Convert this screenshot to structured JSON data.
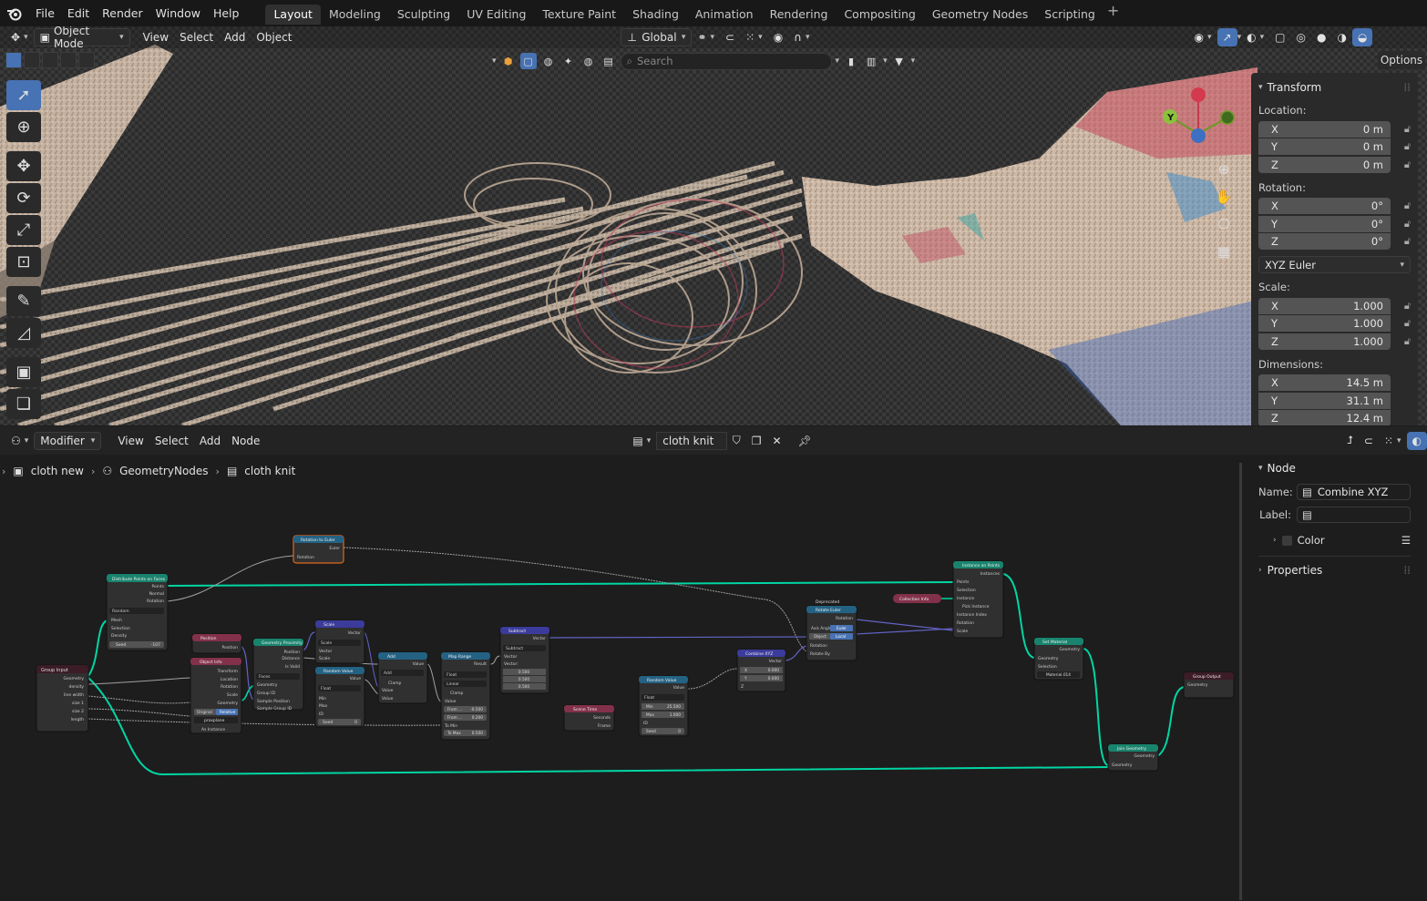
{
  "menu": {
    "items": [
      "File",
      "Edit",
      "Render",
      "Window",
      "Help"
    ]
  },
  "workspaces": {
    "tabs": [
      "Layout",
      "Modeling",
      "Sculpting",
      "UV Editing",
      "Texture Paint",
      "Shading",
      "Animation",
      "Rendering",
      "Compositing",
      "Geometry Nodes",
      "Scripting"
    ],
    "active": "Layout"
  },
  "viewport": {
    "mode": "Object Mode",
    "menus": [
      "View",
      "Select",
      "Add",
      "Object"
    ],
    "orientation": "Global",
    "search_placeholder": "Search",
    "options_label": "Options",
    "gizmo_labels": {
      "y": "Y"
    }
  },
  "transform_panel": {
    "title": "Transform",
    "location_label": "Location:",
    "location": [
      {
        "axis": "X",
        "value": "0 m"
      },
      {
        "axis": "Y",
        "value": "0 m"
      },
      {
        "axis": "Z",
        "value": "0 m"
      }
    ],
    "rotation_label": "Rotation:",
    "rotation": [
      {
        "axis": "X",
        "value": "0°"
      },
      {
        "axis": "Y",
        "value": "0°"
      },
      {
        "axis": "Z",
        "value": "0°"
      }
    ],
    "rotation_mode": "XYZ Euler",
    "scale_label": "Scale:",
    "scale": [
      {
        "axis": "X",
        "value": "1.000"
      },
      {
        "axis": "Y",
        "value": "1.000"
      },
      {
        "axis": "Z",
        "value": "1.000"
      }
    ],
    "dimensions_label": "Dimensions:",
    "dimensions": [
      {
        "axis": "X",
        "value": "14.5 m"
      },
      {
        "axis": "Y",
        "value": "31.1 m"
      },
      {
        "axis": "Z",
        "value": "12.4 m"
      }
    ]
  },
  "node_editor": {
    "context": "Modifier",
    "menus": [
      "View",
      "Select",
      "Add",
      "Node"
    ],
    "node_tree": "cloth knit",
    "breadcrumb": [
      "cloth new",
      "GeometryNodes",
      "cloth knit"
    ]
  },
  "node_panel": {
    "title": "Node",
    "name_label": "Name:",
    "name_value": "Combine XYZ",
    "label_label": "Label:",
    "label_value": "",
    "color_label": "Color",
    "properties_label": "Properties"
  },
  "nodes": {
    "group_input": {
      "title": "Group Input",
      "sockets": [
        "Geometry",
        "density",
        "line width",
        "size 1",
        "size 2",
        "length"
      ]
    },
    "distribute": {
      "title": "Distribute Points on Faces",
      "outputs": [
        "Points",
        "Normal",
        "Rotation"
      ],
      "mode": "Random",
      "inputs": [
        "Mesh",
        "Selection",
        "Density"
      ],
      "seed_label": "Seed",
      "seed_value": "-107"
    },
    "rotation_to_euler": {
      "title": "Rotation to Euler",
      "output": "Euler",
      "input": "Rotation"
    },
    "position": {
      "title": "Position",
      "output": "Position"
    },
    "object_info": {
      "title": "Object Info",
      "outputs": [
        "Transform",
        "Location",
        "Rotation",
        "Scale",
        "Geometry"
      ],
      "toggle_a": "Original",
      "toggle_b": "Relative",
      "object": "proxplane",
      "as_instance": "As Instance"
    },
    "geometry_proximity": {
      "title": "Geometry Proximity",
      "outputs": [
        "Position",
        "Distance",
        "Is Valid"
      ],
      "mode": "Faces",
      "inputs": [
        "Geometry",
        "Group ID",
        "Sample Position",
        "Sample Group ID"
      ]
    },
    "scale": {
      "title": "Scale",
      "output": "Vector",
      "mode": "Scale",
      "inputs": [
        "Vector",
        "Scale"
      ]
    },
    "random_value_1": {
      "title": "Random Value",
      "output": "Value",
      "type": "Float",
      "inputs": [
        "Min",
        "Max",
        "ID"
      ],
      "seed_label": "Seed",
      "seed_value": "0"
    },
    "add": {
      "title": "Add",
      "output": "Value",
      "mode": "Add",
      "clamp": "Clamp",
      "inputs": [
        "Value",
        "Value"
      ]
    },
    "map_range": {
      "title": "Map Range",
      "output": "Result",
      "type": "Float",
      "interp": "Linear",
      "clamp": "Clamp",
      "inputs": [
        "Value",
        "From ...",
        "From ...",
        "To Min",
        "To Max"
      ],
      "values": [
        "-0.500",
        "0.200",
        "",
        "0.500"
      ]
    },
    "subtract": {
      "title": "Subtract",
      "output": "Vector",
      "mode": "Subtract",
      "input": "Vector",
      "vector_label": "Vector:",
      "values": [
        "0.500",
        "0.500",
        "0.500"
      ]
    },
    "scene_time": {
      "title": "Scene Time",
      "outputs": [
        "Seconds",
        "Frame"
      ]
    },
    "random_value_2": {
      "title": "Random Value",
      "output": "Value",
      "type": "Float",
      "min_label": "Min",
      "min": "25.500",
      "max_label": "Max",
      "max": "1.000",
      "id_label": "ID",
      "seed_label": "Seed",
      "seed": "0"
    },
    "combine_xyz": {
      "title": "Combine XYZ",
      "output": "Vector",
      "x_label": "X",
      "x": "0.000",
      "y_label": "Y",
      "y": "0.000",
      "z_label": "Z"
    },
    "rotate_euler": {
      "deprecated": "Deprecated",
      "title": "Rotate Euler",
      "output": "Rotation",
      "axis_label": "Axis Angle",
      "euler": "Euler",
      "object": "Object",
      "local": "Local",
      "inputs": [
        "Rotation",
        "Rotate By"
      ]
    },
    "collection_info": {
      "title": "Collection Info"
    },
    "instance_on_points": {
      "title": "Instance on Points",
      "output": "Instances",
      "inputs": [
        "Points",
        "Selection",
        "Instance",
        "Pick Instance",
        "Instance Index",
        "Rotation",
        "Scale"
      ]
    },
    "set_material": {
      "title": "Set Material",
      "output": "Geometry",
      "inputs": [
        "Geometry",
        "Selection"
      ],
      "material": "Material.014"
    },
    "join_geometry": {
      "title": "Join Geometry",
      "output": "Geometry",
      "input": "Geometry"
    },
    "group_output": {
      "title": "Group Output",
      "input": "Geometry"
    }
  },
  "colors": {
    "accent": "#4772b3",
    "geometry_link": "#00d6a3",
    "vector_link": "#6363c7",
    "float_link": "#a1a1a1",
    "header_geometry": "#19846d",
    "header_input": "#83314a",
    "header_converter": "#246283",
    "header_vector": "#3b3b9b"
  }
}
